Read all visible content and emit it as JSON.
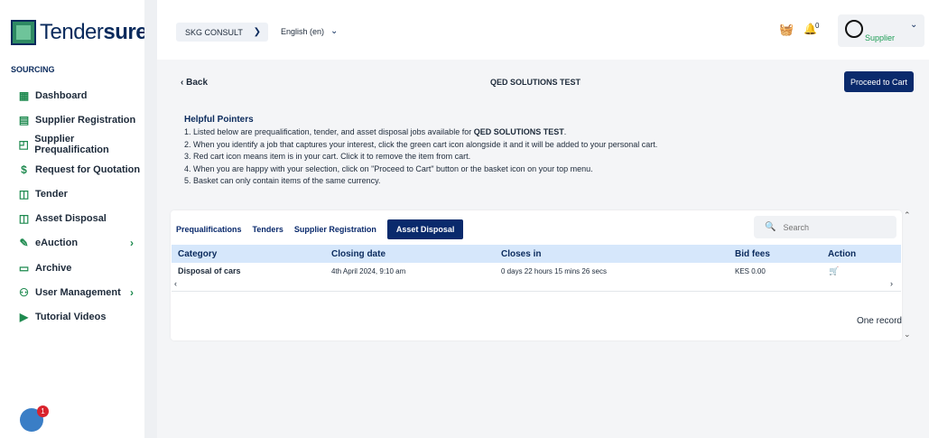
{
  "brand": {
    "logo_text_a": "Tender",
    "logo_text_b": "sure",
    "tm": "™"
  },
  "sidebar": {
    "section": "SOURCING",
    "items": [
      {
        "label": "Dashboard",
        "icon": "▦",
        "arrow": ""
      },
      {
        "label": "Supplier Registration",
        "icon": "▤",
        "arrow": ""
      },
      {
        "label": "Supplier Prequalification",
        "icon": "◰",
        "arrow": ""
      },
      {
        "label": "Request for Quotation",
        "icon": "$",
        "arrow": ""
      },
      {
        "label": "Tender",
        "icon": "◫",
        "arrow": ""
      },
      {
        "label": "Asset Disposal",
        "icon": "◫",
        "arrow": ""
      },
      {
        "label": "eAuction",
        "icon": "✎",
        "arrow": "›"
      },
      {
        "label": "Archive",
        "icon": "▭",
        "arrow": ""
      },
      {
        "label": "User Management",
        "icon": "⚇",
        "arrow": "›"
      },
      {
        "label": "Tutorial Videos",
        "icon": "▶",
        "arrow": ""
      }
    ],
    "chat_badge": "1"
  },
  "topbar": {
    "company": "SKG CONSULT",
    "language": "English (en)",
    "bell_count": "0",
    "user_role": "Supplier"
  },
  "page": {
    "back_label": "Back",
    "title": "QED SOLUTIONS TEST",
    "proceed_label": "Proceed to Cart"
  },
  "pointers": {
    "title": "Helpful Pointers",
    "line1_pre": "1. Listed below are prequalification, tender, and asset disposal jobs available for ",
    "line1_bold": "QED SOLUTIONS TEST",
    "line1_post": ".",
    "line2": "2. When you identify a job that captures your interest, click the green cart icon alongside it and it will be added to your personal cart.",
    "line3": "3. Red cart icon means item is in your cart. Click it to remove the item from cart.",
    "line4": "4. When you are happy with your selection, click on \"Proceed to Cart\" button or the basket icon on your top menu.",
    "line5": "5. Basket can only contain items of the same currency."
  },
  "tabs": [
    "Prequalifications",
    "Tenders",
    "Supplier Registration",
    "Asset Disposal"
  ],
  "active_tab": "Asset Disposal",
  "search": {
    "placeholder": "Search"
  },
  "table": {
    "headers": [
      "Category",
      "Closing date",
      "Closes in",
      "Bid fees",
      "Action"
    ],
    "rows": [
      {
        "category": "Disposal of cars",
        "closing_date": "4th April 2024, 9:10 am",
        "closes_in": "0 days 22 hours 15 mins 26 secs",
        "bid_fees": "KES 0.00",
        "action_icon": "cart-icon"
      }
    ],
    "record_count": "One record"
  },
  "colors": {
    "primary": "#0a2a6c",
    "accent_green": "#1e9d55",
    "header_row": "#d6e7fb"
  }
}
